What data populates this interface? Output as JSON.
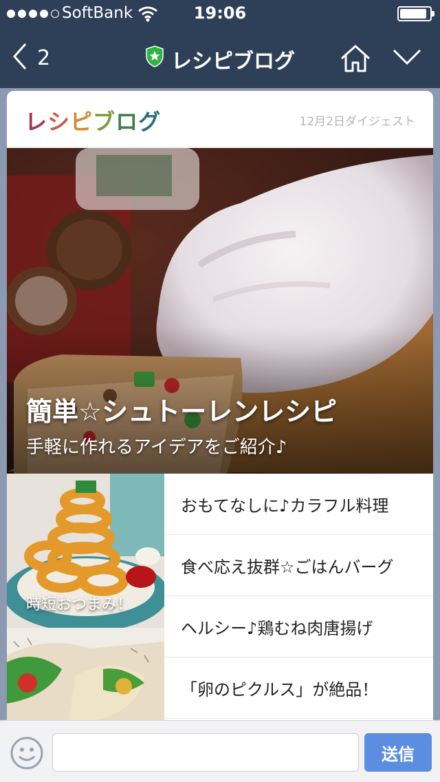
{
  "status_bar": {
    "carrier": "SoftBank",
    "time": "19:06",
    "battery_level": 0.8
  },
  "nav": {
    "back_count": "2",
    "title": "レシピブログ",
    "official_badge_color": "#2fb344",
    "background_color": "#2e3f58"
  },
  "card": {
    "brand_logo": [
      "レ",
      "シ",
      "ピ",
      "ブ",
      "ロ",
      "グ"
    ],
    "digest_label": "12月2日ダイジェスト",
    "hero": {
      "title": "簡単☆シュトーレンレシピ",
      "subtitle": "手軽に作れるアイデアをご紹介♪"
    },
    "thumb_caption": "時短おつまみ！",
    "links": [
      "おもてなしに♪カラフル料理",
      "食べ応え抜群☆ごはんバーグ",
      "ヘルシー♪鶏むね肉唐揚げ",
      "「卵のピクルス」が絶品！"
    ]
  },
  "input_bar": {
    "input_value": "",
    "send_label": "送信",
    "send_color": "#5b8ee0"
  }
}
